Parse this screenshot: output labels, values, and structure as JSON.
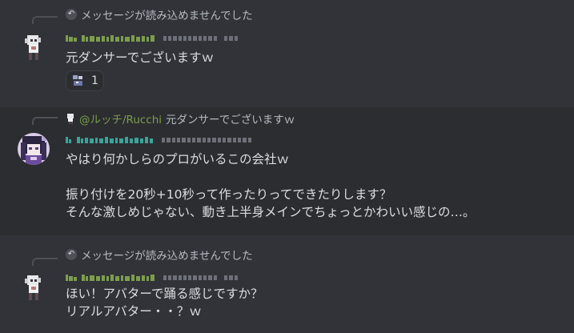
{
  "messages": [
    {
      "reply": {
        "text": "メッセージが読み込めませんでした"
      },
      "content": "元ダンサーでございますｗ",
      "reaction": {
        "emoji": "sticker-emoji",
        "count": "1"
      }
    },
    {
      "reply": {
        "user": "@ルッチ/Rucchi",
        "text": "元ダンサーでございますｗ"
      },
      "content": "やはり何かしらのプロがいるこの会社ｗ\n\n振り付けを20秒+10秒って作ったりってできたりします？\nそんな激しめじゃない、動き上半身メインでちょっとかわいい感じの…。"
    },
    {
      "reply": {
        "text": "メッセージが読み込めませんでした"
      },
      "content": "ほい！アバターで踊る感じですか？\nリアルアバター・・？ｗ"
    }
  ],
  "colors": {
    "background": "#313338",
    "username_green": "#7c9d4c",
    "username_teal": "#3aa39a",
    "text": "#dbdee1",
    "muted": "#b5bac1"
  }
}
